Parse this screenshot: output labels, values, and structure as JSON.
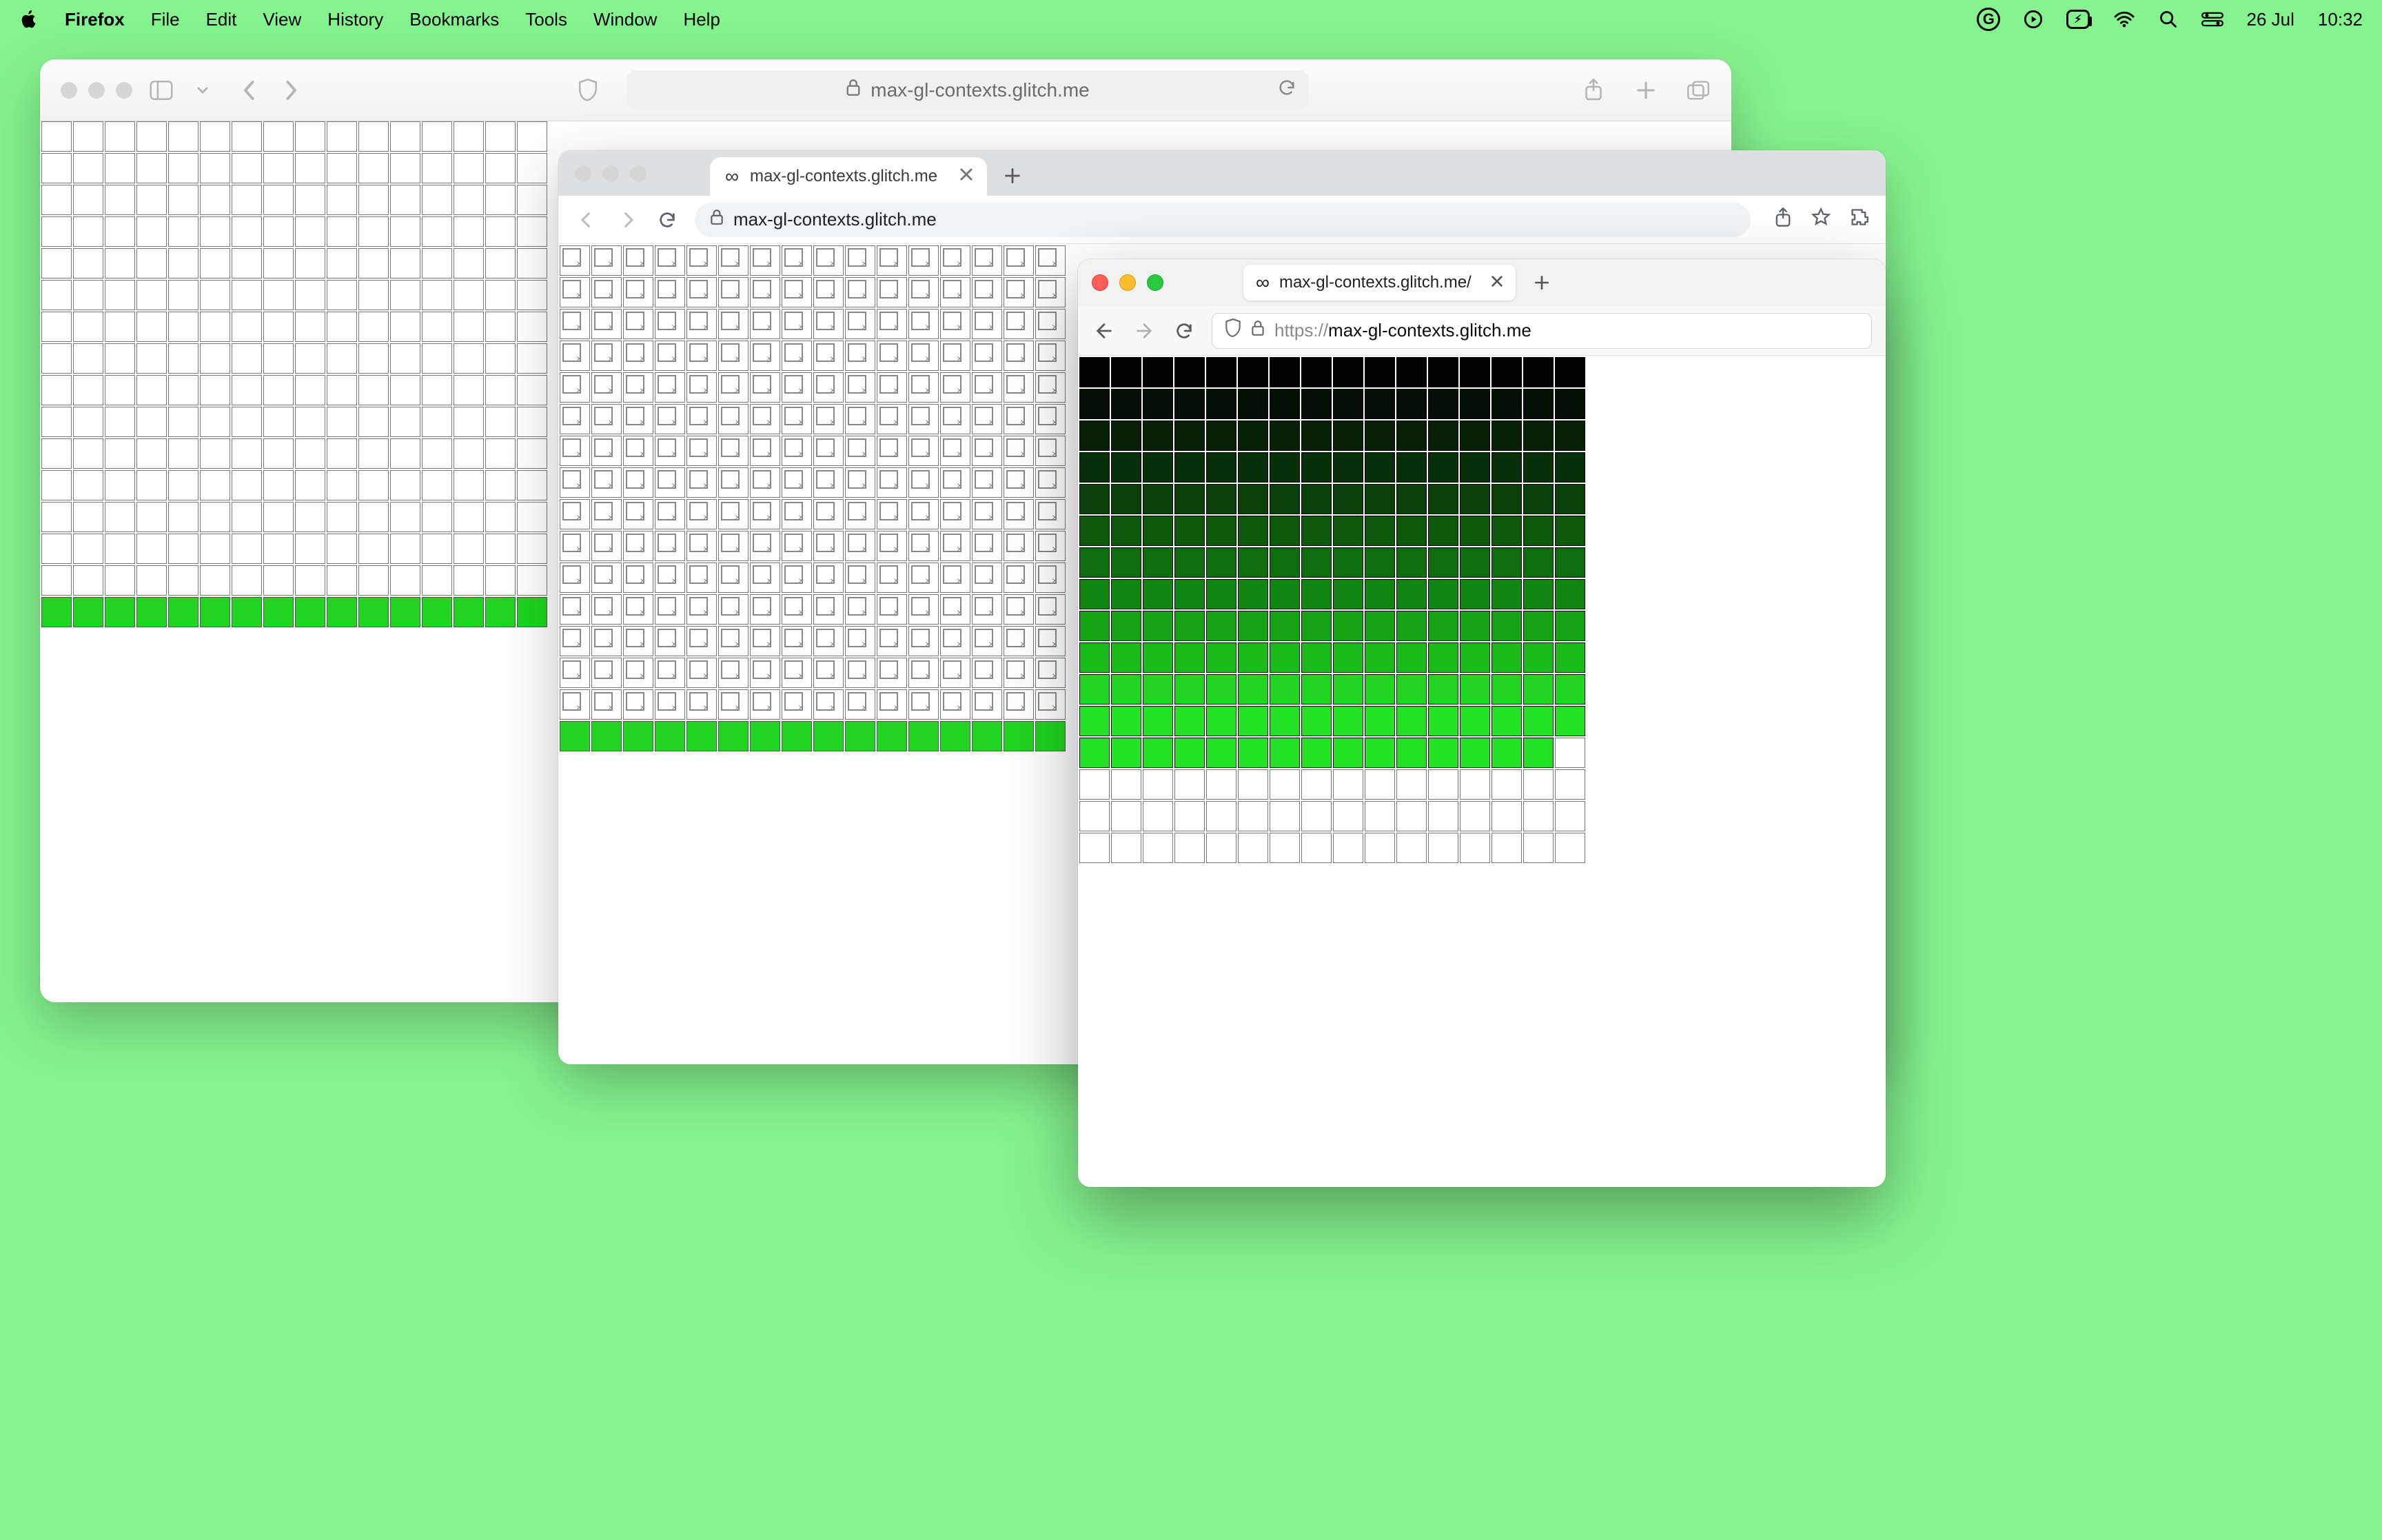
{
  "menubar": {
    "app": "Firefox",
    "items": [
      "File",
      "Edit",
      "View",
      "History",
      "Bookmarks",
      "Tools",
      "Window",
      "Help"
    ],
    "battery_icon_text": "⚡︎",
    "date": "26 Jul",
    "time": "10:32"
  },
  "safari": {
    "address_display": "max-gl-contexts.glitch.me",
    "lock_label": "lock",
    "grid": {
      "cols": 16,
      "rows": 16,
      "green_row_index": 15
    }
  },
  "chrome": {
    "tab_title": "max-gl-contexts.glitch.me",
    "tab_favicon": "∞",
    "address_display": "max-gl-contexts.glitch.me",
    "grid": {
      "cols": 16,
      "rows": 16,
      "broken_rows": 15,
      "green_row_index": 15
    }
  },
  "firefox": {
    "tab_title": "max-gl-contexts.glitch.me/",
    "tab_favicon": "∞",
    "url_scheme": "https://",
    "url_host": "max-gl-contexts.glitch.me",
    "grid": {
      "cols": 16,
      "rows": 16,
      "gradient_rows": 12,
      "gradient_rgb": [
        "#000000",
        "#041004",
        "#062006",
        "#083008",
        "#0a400a",
        "#0c590c",
        "#0e6e0e",
        "#108610",
        "#14a214",
        "#18bb18",
        "#1fd51f",
        "#24e324"
      ],
      "partial_last_row_filled": 15
    }
  }
}
